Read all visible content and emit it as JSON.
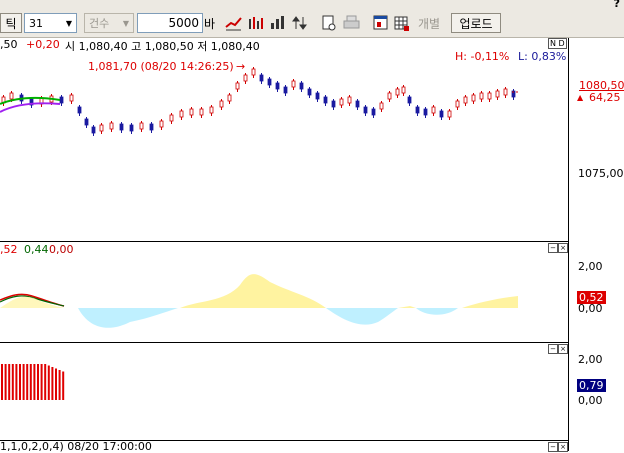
{
  "toolbar": {
    "tick_label": "틱",
    "period_value": "31",
    "count_select": "건수",
    "count_input": "5000",
    "count_unit": "바",
    "disabled_label": "개별",
    "upload_label": "업로드",
    "top_right_glyph": "?",
    "icons": [
      "line-chart-icon",
      "bar-chart-icon",
      "volume-bar-icon",
      "up-down-arrow-icon",
      "document-icon",
      "print-icon",
      "window-icon",
      "grid-icon"
    ]
  },
  "price_pane": {
    "info_prefix": ",50",
    "info_change": "+0,20",
    "info_ohl": "시 1,080,40 고 1,080,50 저 1,080,40",
    "high_pct": "H: -0,11%",
    "low_pct": "L: 0,83%",
    "annotation": "1,081,70 (08/20 14:26:25)",
    "annotation_arrow": "→",
    "badge": "N D",
    "current_price": "1080,50",
    "change_marker": "▲",
    "change_value": "64,25",
    "axis_label": "1075,00"
  },
  "osc_pane": {
    "values_a": ",52",
    "values_b": "0,44",
    "values_c": "0,00",
    "axis_top": "2,00",
    "axis_zero": "0,00",
    "current_tag": "0,52"
  },
  "vol_pane": {
    "axis_top": "2,00",
    "axis_zero": "0,00",
    "current_tag": "0,79"
  },
  "bottom_pane": {
    "footer_text": "1,1,0,2,0,4) 08/20 17:00:00"
  },
  "colors": {
    "up": "#d00000",
    "down": "#1a1aa0",
    "osc_positive": "#fff3a0",
    "osc_negative": "#bff0ff",
    "ma_green": "#00b000",
    "ma_purple": "#a020f0",
    "tag_blue": "#000080"
  }
}
